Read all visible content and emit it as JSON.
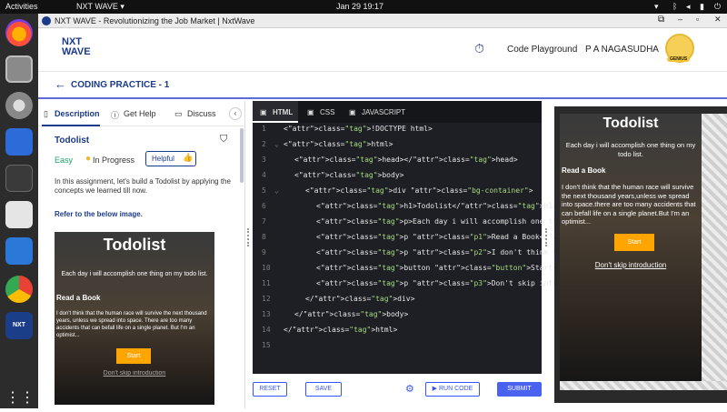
{
  "system": {
    "activities": "Activities",
    "app_menu": "NXT WAVE ▾",
    "datetime": "Jan 29  19:17",
    "tray_icons": [
      "wifi-icon",
      "bluetooth-icon",
      "volume-icon",
      "battery-icon",
      "power-icon"
    ]
  },
  "window": {
    "title": "NXT WAVE - Revolutionizing the Job Market | NxtWave"
  },
  "header": {
    "logo_line1": "NXT",
    "logo_line2": "WAVE",
    "code_playground": "Code Playground",
    "username": "P A NAGASUDHA",
    "badge": "GENIUS"
  },
  "subheader": {
    "back": "←",
    "title": "CODING PRACTICE - 1"
  },
  "left": {
    "tabs": {
      "description": "Description",
      "gethelp": "Get Help",
      "discuss": "Discuss"
    },
    "card_title": "Todolist",
    "difficulty": "Easy",
    "status": "In Progress",
    "helpful": "Helpful",
    "paragraph": "In this assignment, let's build a Todolist by applying the concepts we learned till now.",
    "refer": "Refer to the below image.",
    "img_title": "Todolist",
    "img_p1": "Each day i will accomplish one thing on my todo list.",
    "img_h": "Read a Book",
    "img_p2": "I don't think that the human race will survive the next thousand years, unless we spread into space. There are too many accidents that can befall life on a single planet. But I'm an optimist...",
    "img_button": "Start",
    "img_link": "Don't skip introduction"
  },
  "editor": {
    "tabs": [
      "HTML",
      "CSS",
      "JAVASCRIPT"
    ],
    "lines": [
      {
        "n": "1",
        "t": "<!DOCTYPE html>"
      },
      {
        "n": "2",
        "t": "<html>"
      },
      {
        "n": "3",
        "t": "<head></head>"
      },
      {
        "n": "4",
        "t": "<body>"
      },
      {
        "n": "5",
        "t": "<div class=\"bg-container\">"
      },
      {
        "n": "6",
        "t": "<h1>Todolist</h1>"
      },
      {
        "n": "7",
        "t": "<p>Each day i will accomplish one thing on my todo l"
      },
      {
        "n": "8",
        "t": "<p class=\"p1\">Read a Book</p>"
      },
      {
        "n": "9",
        "t": "<p class=\"p2\">I don't think that the human race will"
      },
      {
        "n": "10",
        "t": "<button class=\"button\">Start</button>"
      },
      {
        "n": "11",
        "t": "<p class=\"p3\">Don't skip introduction</p>"
      },
      {
        "n": "12",
        "t": "</div>"
      },
      {
        "n": "13",
        "t": "</body>"
      },
      {
        "n": "14",
        "t": "</html>"
      },
      {
        "n": "15",
        "t": ""
      }
    ]
  },
  "actions": {
    "reset": "RESET",
    "save": "SAVE",
    "run": "RUN CODE",
    "submit": "SUBMIT"
  },
  "preview": {
    "title": "Todolist",
    "p1": "Each day i will accomplish one thing on my todo list.",
    "h": "Read a Book",
    "p2": "I don't think that the human race will survive the next thousand years,unless we spread into space.there are too many accidents that can befall life on a single planet.But I'm an optimist...",
    "button": "Start",
    "link": "Don't skip introduction"
  },
  "colors": {
    "accent": "#5d6bd6",
    "primary_button": "#4a62f0",
    "start_button": "#ffa500",
    "easy": "#1fa26b",
    "in_progress_dot": "#f3b61f"
  }
}
